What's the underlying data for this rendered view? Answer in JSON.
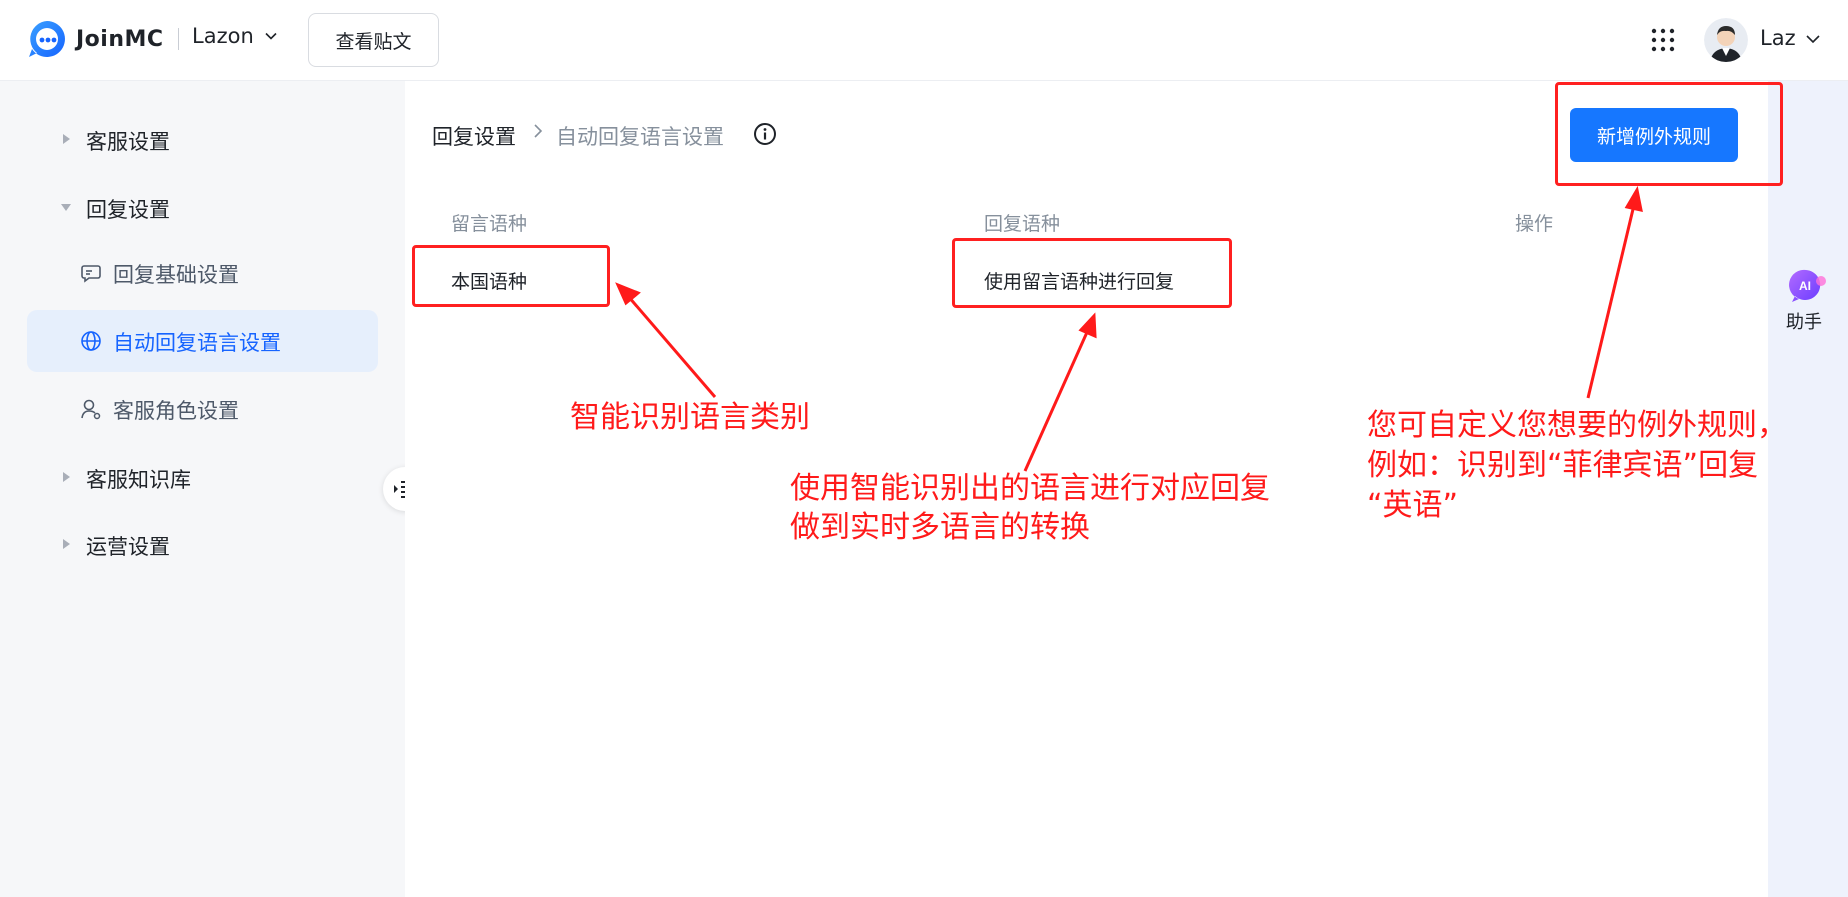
{
  "header": {
    "brand": "JoinMC",
    "workspace": "Lazon",
    "view_post_button": "查看贴文",
    "user_name": "Laz"
  },
  "sidebar": {
    "groups": [
      {
        "label": "客服设置",
        "expanded": false
      },
      {
        "label": "回复设置",
        "expanded": true
      },
      {
        "label": "客服知识库",
        "expanded": false
      },
      {
        "label": "运营设置",
        "expanded": false
      }
    ],
    "subitems": [
      {
        "label": "回复基础设置",
        "icon": "chat-settings-icon",
        "active": false
      },
      {
        "label": "自动回复语言设置",
        "icon": "globe-icon",
        "active": true
      },
      {
        "label": "客服角色设置",
        "icon": "user-role-icon",
        "active": false
      }
    ]
  },
  "main": {
    "breadcrumb": [
      "回复设置",
      "自动回复语言设置"
    ],
    "add_button": "新增例外规则",
    "table": {
      "headers": [
        "留言语种",
        "回复语种",
        "操作"
      ],
      "rows": [
        {
          "message_language": "本国语种",
          "reply_language": "使用留言语种进行回复",
          "actions": ""
        }
      ]
    }
  },
  "assistant": {
    "badge": "AI",
    "label": "助手"
  },
  "annotations": {
    "note_1": "智能识别语言类别",
    "note_2_line1": "使用智能识别出的语言进行对应回复",
    "note_2_line2": "做到实时多语言的转换",
    "note_3_line1": "您可自定义您想要的例外规则，",
    "note_3_line2": "例如：识别到“菲律宾语”回复",
    "note_3_line3": "“英语”"
  },
  "colors": {
    "primary": "#1677ff",
    "active_bg": "#e6effc",
    "annotation_red": "#ff1a1a"
  }
}
